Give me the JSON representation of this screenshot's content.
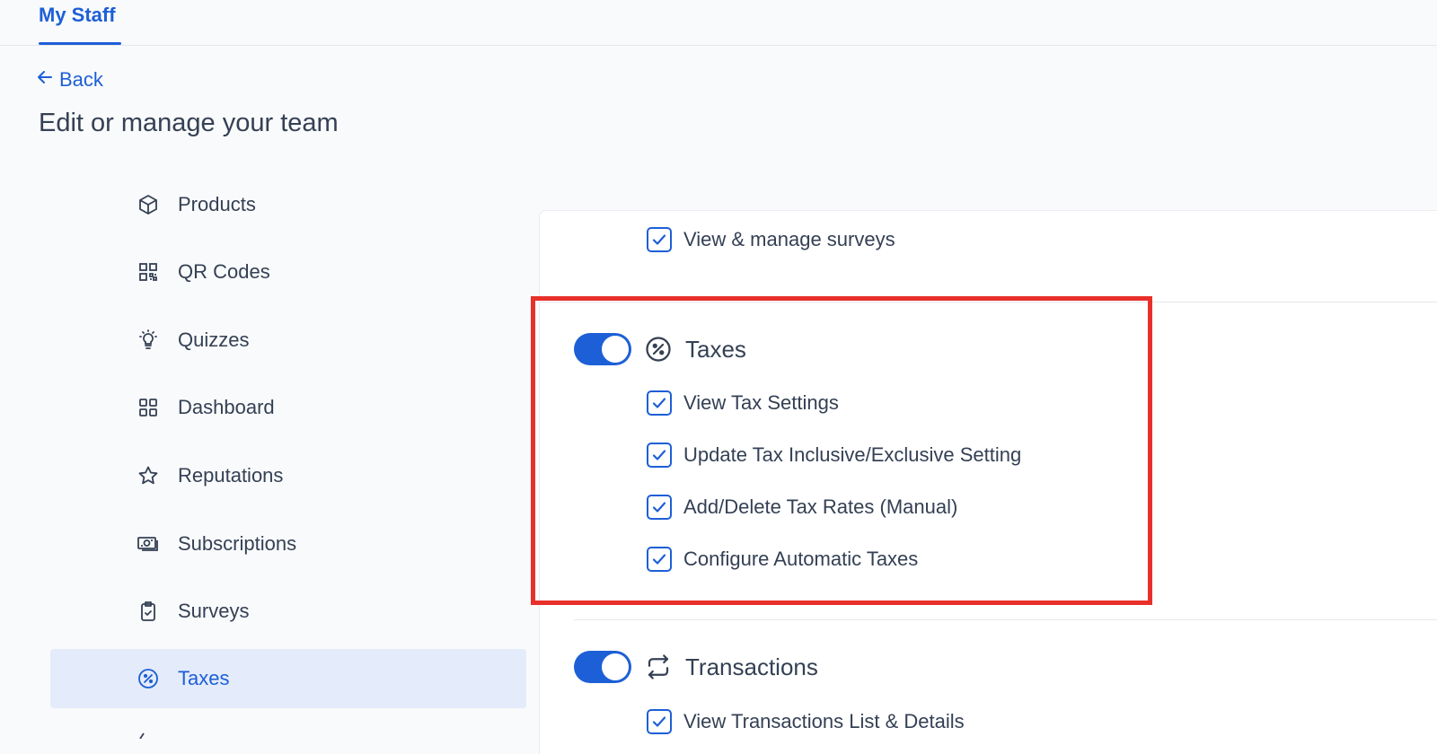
{
  "header": {
    "tab_label": "My Staff"
  },
  "nav": {
    "back_label": "Back"
  },
  "page": {
    "title": "Edit or manage your team"
  },
  "sidebar": {
    "items": [
      {
        "label": "Products",
        "icon": "box-icon"
      },
      {
        "label": "QR Codes",
        "icon": "qr-code-icon"
      },
      {
        "label": "Quizzes",
        "icon": "lightbulb-icon"
      },
      {
        "label": "Dashboard",
        "icon": "grid-icon"
      },
      {
        "label": "Reputations",
        "icon": "star-icon"
      },
      {
        "label": "Subscriptions",
        "icon": "money-icon"
      },
      {
        "label": "Surveys",
        "icon": "clipboard-check-icon"
      },
      {
        "label": "Taxes",
        "icon": "percent-circle-icon",
        "active": true
      }
    ]
  },
  "surveys_section": {
    "permissions": [
      {
        "label": "View & manage surveys",
        "checked": true
      }
    ]
  },
  "taxes_section": {
    "title": "Taxes",
    "enabled": true,
    "permissions": [
      {
        "label": "View Tax Settings",
        "checked": true
      },
      {
        "label": "Update Tax Inclusive/Exclusive Setting",
        "checked": true
      },
      {
        "label": "Add/Delete Tax Rates (Manual)",
        "checked": true
      },
      {
        "label": "Configure Automatic Taxes",
        "checked": true
      }
    ]
  },
  "transactions_section": {
    "title": "Transactions",
    "enabled": true,
    "permissions": [
      {
        "label": "View Transactions List & Details",
        "checked": true
      }
    ]
  },
  "colors": {
    "accent": "#1d5fd6",
    "highlight_border": "#e8302a",
    "active_bg": "#e4ebfa"
  }
}
